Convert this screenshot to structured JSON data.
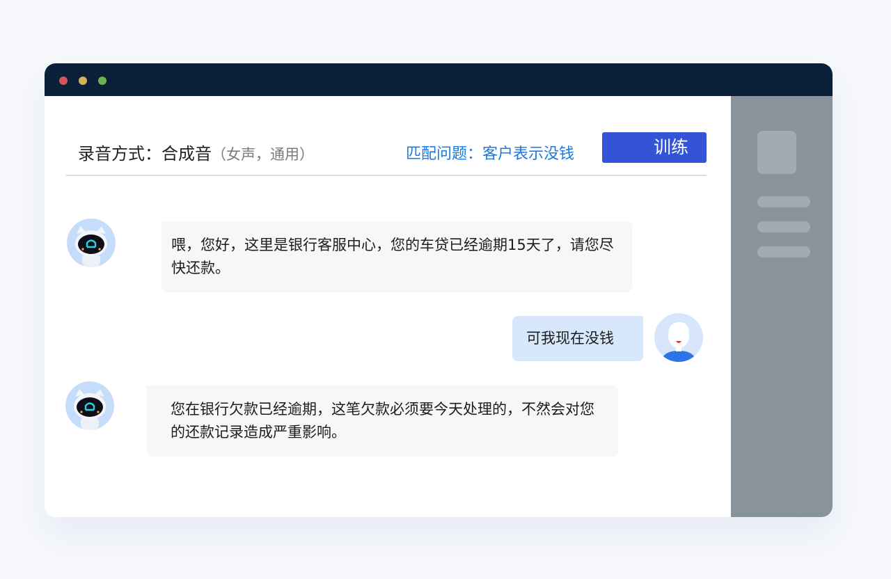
{
  "window": {
    "controls": [
      "close",
      "minimize",
      "maximize"
    ],
    "titlebar_color": "#0a2038"
  },
  "header": {
    "recording_mode_label": "录音方式：合成音",
    "recording_mode_sub": "（女声，通用）",
    "match_question": "匹配问题：客户表示没钱",
    "train_button": "训练"
  },
  "messages": [
    {
      "role": "bot",
      "avatar": "robot-avatar-icon",
      "text": "喂，您好，这里是银行客服中心，您的车贷已经逾期15天了，请您尽快还款。"
    },
    {
      "role": "user",
      "avatar": "user-avatar-icon",
      "text": "可我现在没钱"
    },
    {
      "role": "bot",
      "avatar": "robot-avatar-icon",
      "text": "您在银行欠款已经逾期，这笔欠款必须要今天处理的，不然会对您的还款记录造成严重影响。"
    }
  ],
  "colors": {
    "accent": "#3454d8",
    "link": "#1a7ae0",
    "sidebar": "#89939c",
    "bot_bubble": "#f7f7f7",
    "user_bubble": "#d7e8fc"
  }
}
